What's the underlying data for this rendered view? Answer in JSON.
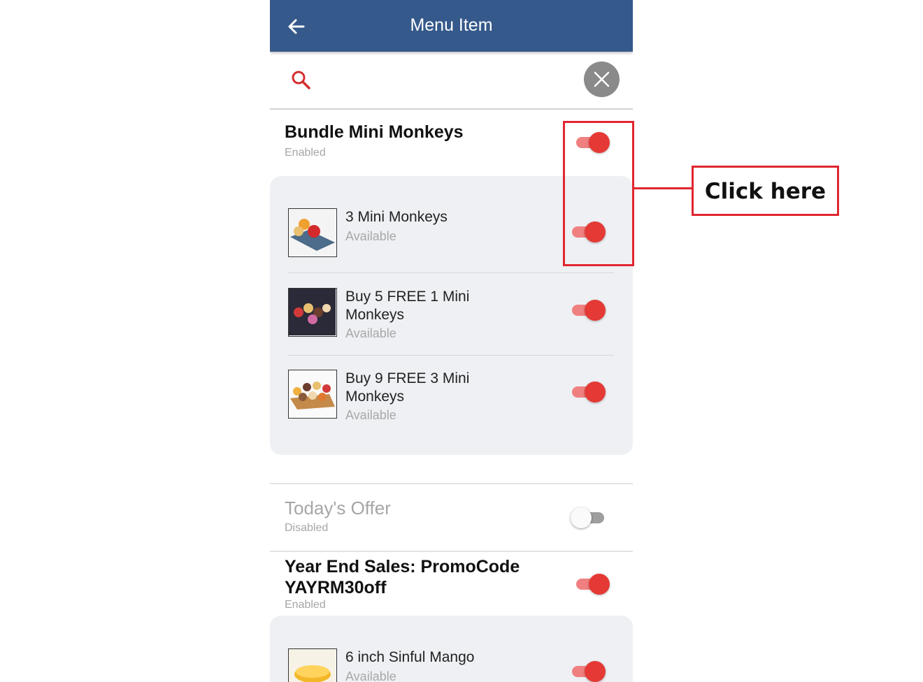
{
  "appbar": {
    "title": "Menu Item",
    "back_icon": "arrow-left-icon"
  },
  "search": {
    "icon": "search-icon",
    "clear_icon": "close-icon",
    "accent": "#d32f2f"
  },
  "colors": {
    "appbar": "#35598a",
    "toggle_on": "#e53935",
    "callout": "#e0262f"
  },
  "sections": [
    {
      "title": "Bundle Mini Monkeys",
      "status": "Enabled",
      "toggle_on": true,
      "items": [
        {
          "name": "3 Mini Monkeys",
          "status": "Available",
          "toggle_on": true
        },
        {
          "name": "Buy 5 FREE 1 Mini Monkeys",
          "name_line1": "Buy 5 FREE 1 Mini",
          "name_line2": "Monkeys",
          "status": "Available",
          "toggle_on": true
        },
        {
          "name": "Buy 9 FREE 3 Mini Monkeys",
          "name_line1": "Buy 9 FREE 3 Mini",
          "name_line2": "Monkeys",
          "status": "Available",
          "toggle_on": true
        }
      ]
    },
    {
      "title": "Today's Offer",
      "status": "Disabled",
      "toggle_on": false,
      "items": []
    },
    {
      "title": "Year End Sales: PromoCode YAYRM30off",
      "title_line1": "Year End Sales: PromoCode",
      "title_line2": "YAYRM30off",
      "status": "Enabled",
      "toggle_on": true,
      "items": [
        {
          "name": "6 inch Sinful Mango",
          "status": "Available",
          "toggle_on": true
        }
      ]
    }
  ],
  "callout": {
    "label": "Click here"
  }
}
